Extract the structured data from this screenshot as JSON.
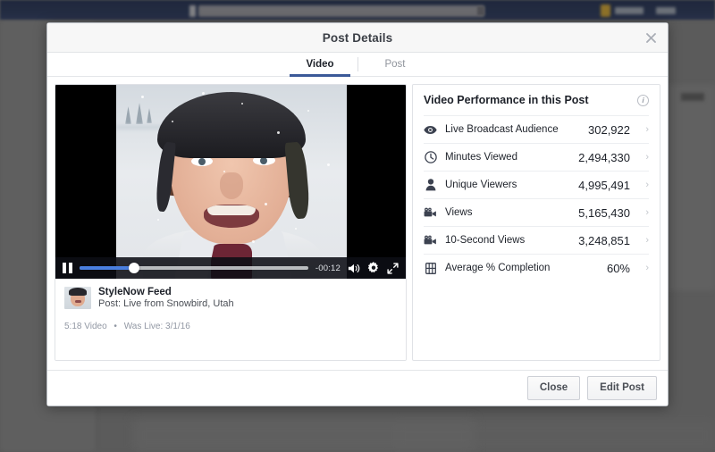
{
  "modal": {
    "title": "Post Details",
    "close_icon": "close-icon",
    "tabs": [
      {
        "label": "Video",
        "active": true
      },
      {
        "label": "Post",
        "active": false
      }
    ],
    "footer": {
      "close_label": "Close",
      "edit_label": "Edit Post"
    }
  },
  "video": {
    "controls": {
      "pause_icon": "pause-icon",
      "time_remaining": "-00:12",
      "progress_percent": "24",
      "volume_icon": "volume-icon",
      "settings_icon": "gear-icon",
      "fullscreen_icon": "expand-icon"
    },
    "post": {
      "page_name": "StyleNow Feed",
      "description": "Post: Live from Snowbird, Utah",
      "duration_label": "5:18 Video",
      "separator": "•",
      "live_label": "Was Live: 3/1/16"
    }
  },
  "metrics": {
    "title": "Video Performance in this Post",
    "info_icon": "info-icon",
    "info_glyph": "i",
    "chevron": "›",
    "rows": [
      {
        "icon": "eye-icon",
        "label": "Live Broadcast Audience",
        "value": "302,922"
      },
      {
        "icon": "clock-icon",
        "label": "Minutes Viewed",
        "value": "2,494,330"
      },
      {
        "icon": "person-icon",
        "label": "Unique Viewers",
        "value": "4,995,491"
      },
      {
        "icon": "video-camera-icon",
        "label": "Views",
        "value": "5,165,430"
      },
      {
        "icon": "video-camera-icon",
        "label": "10-Second Views",
        "value": "3,248,851"
      },
      {
        "icon": "film-strip-icon",
        "label": "Average % Completion",
        "value": "60%"
      }
    ]
  },
  "colors": {
    "accent": "#3b5998",
    "progress": "#4a7fe0",
    "text_primary": "#1d2129",
    "text_muted": "#90949c",
    "backdrop": "#676767",
    "topbar": "#26314c"
  }
}
